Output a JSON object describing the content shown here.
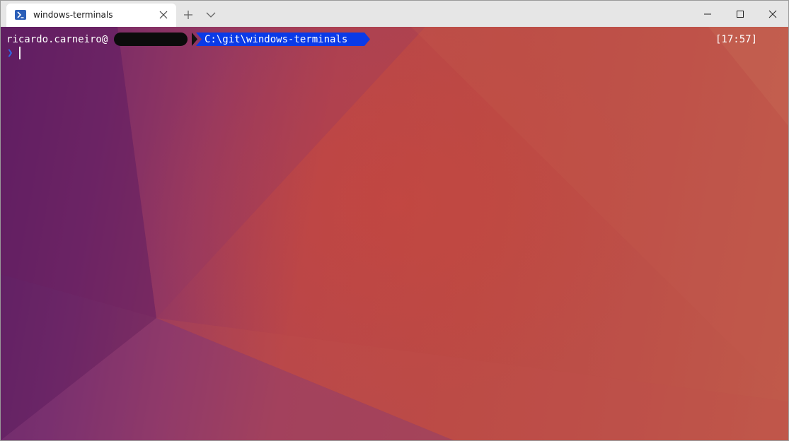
{
  "tab": {
    "title": "windows-terminals",
    "icon": "powershell-icon"
  },
  "toolbar": {
    "new_tab_icon": "plus-icon",
    "dropdown_icon": "chevron-down-icon"
  },
  "window_controls": {
    "minimize_icon": "minimize-icon",
    "maximize_icon": "maximize-icon",
    "close_icon": "close-icon"
  },
  "terminal": {
    "user": "ricardo.carneiro@",
    "path": "C:\\git\\windows-terminals",
    "time": "[17:57]",
    "prompt_symbol": "❯"
  },
  "colors": {
    "path_segment": "#0a3ae8",
    "prompt_symbol": "#2d6cf0",
    "titlebar": "#e6e6e6"
  }
}
